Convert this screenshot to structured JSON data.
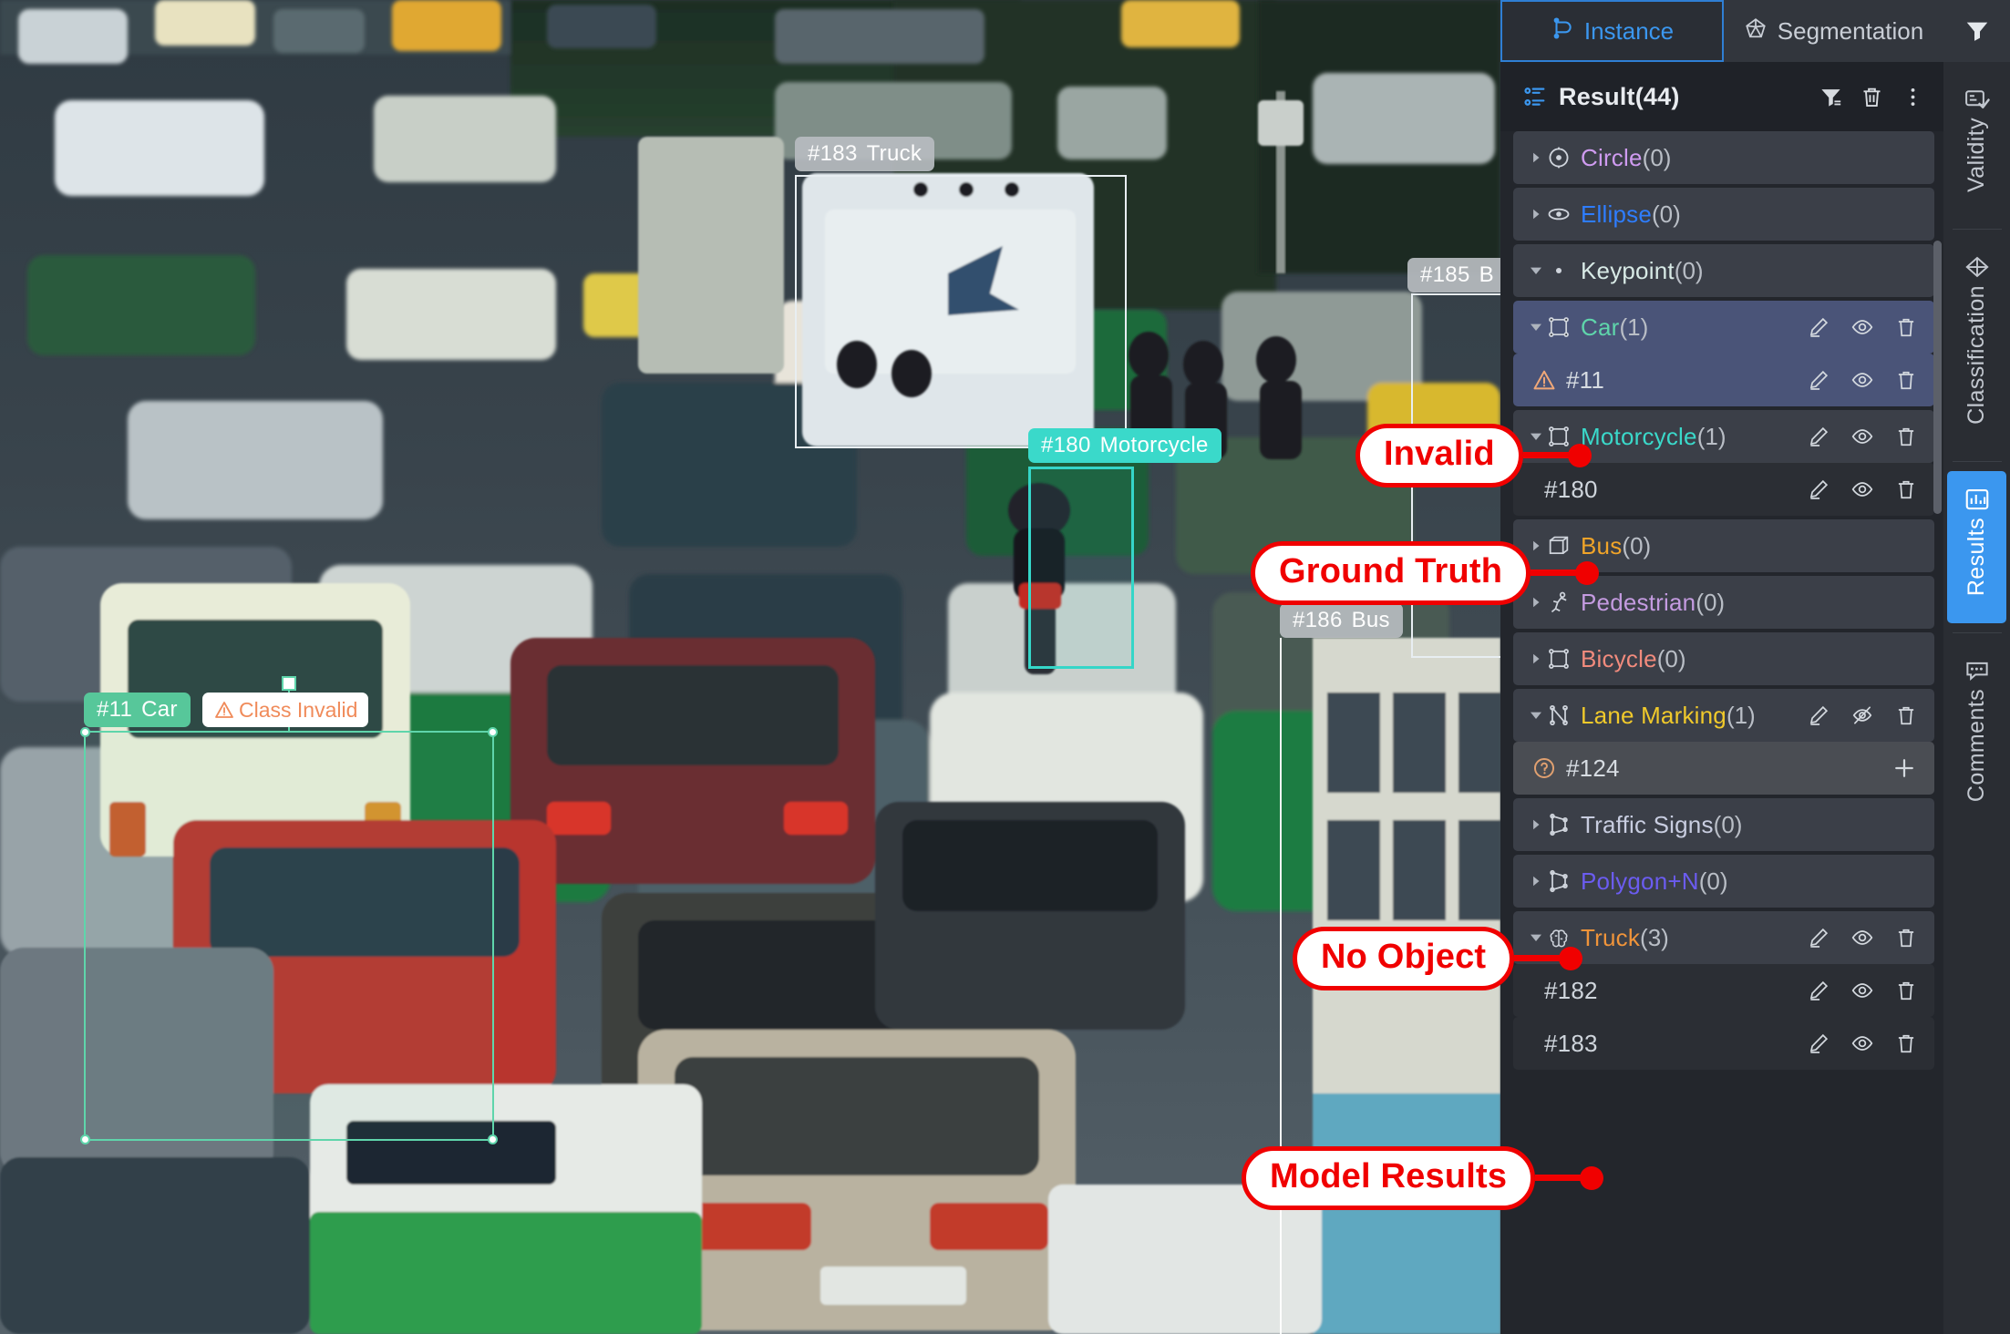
{
  "tabs": {
    "items": [
      {
        "label": "Instance",
        "icon": "polyline-icon",
        "active": true
      },
      {
        "label": "Segmentation",
        "icon": "segmentation-icon",
        "active": false
      }
    ],
    "filter_icon": "filter-icon"
  },
  "result_header": {
    "title": "Result(44)",
    "list_icon": "result-list-icon",
    "filter_label": "filter-icon",
    "delete_label": "trash-icon",
    "more_label": "more-vertical-icon"
  },
  "groups": [
    {
      "name": "Circle",
      "count": "(0)",
      "color": "#cf9bf0",
      "icon": "circle-shape-icon",
      "caret": "right",
      "expanded": false,
      "actions": []
    },
    {
      "name": "Ellipse",
      "count": "(0)",
      "color": "#2e7dff",
      "icon": "ellipse-shape-icon",
      "caret": "right",
      "expanded": false,
      "actions": []
    },
    {
      "name": "Keypoint",
      "count": "(0)",
      "color": "#d8eae6",
      "icon": "keypoint-icon",
      "caret": "down",
      "expanded": true,
      "actions": []
    },
    {
      "name": "Car",
      "count": "(1)",
      "color": "#5fd5ab",
      "icon": "bbox-icon",
      "caret": "down",
      "expanded": true,
      "selected": true,
      "actions": [
        "edit-icon",
        "eye-icon",
        "trash-icon"
      ]
    },
    {
      "name": "Motorcycle",
      "count": "(1)",
      "color": "#3ad9ca",
      "icon": "bbox-icon",
      "caret": "down",
      "expanded": true,
      "actions": [
        "edit-icon",
        "eye-icon",
        "trash-icon"
      ]
    },
    {
      "name": "Bus",
      "count": "(0)",
      "color": "#f0a429",
      "icon": "cuboid-icon",
      "caret": "right",
      "expanded": false,
      "actions": []
    },
    {
      "name": "Pedestrian",
      "count": "(0)",
      "color": "#c49be0",
      "icon": "skeleton-icon",
      "caret": "right",
      "expanded": false,
      "actions": []
    },
    {
      "name": "Bicycle",
      "count": "(0)",
      "color": "#f28b7d",
      "icon": "bbox-icon",
      "caret": "right",
      "expanded": false,
      "actions": []
    },
    {
      "name": "Lane Marking",
      "count": "(1)",
      "color": "#f0c92b",
      "icon": "polyline-shape-icon",
      "caret": "down",
      "expanded": true,
      "actions": [
        "edit-icon",
        "eye-off-icon",
        "trash-icon"
      ]
    },
    {
      "name": "Traffic Signs",
      "count": "(0)",
      "color": "#c8cde0",
      "icon": "polygon-icon",
      "caret": "right",
      "expanded": false,
      "actions": []
    },
    {
      "name": "Polygon+N",
      "count": "(0)",
      "color": "#6b5cf0",
      "icon": "polygon-icon",
      "caret": "right",
      "expanded": false,
      "actions": []
    },
    {
      "name": "Truck",
      "count": "(3)",
      "color": "#f0943a",
      "icon": "brain-icon",
      "caret": "down",
      "expanded": true,
      "actions": [
        "edit-icon",
        "eye-icon",
        "trash-icon"
      ]
    }
  ],
  "children": {
    "Car": [
      {
        "id": "#11",
        "status_icon": "warning-triangle-icon",
        "selected": true,
        "actions": [
          "edit-icon",
          "eye-icon",
          "trash-icon"
        ]
      }
    ],
    "Motorcycle": [
      {
        "id": "#180",
        "status_icon": null,
        "actions": [
          "edit-icon",
          "eye-icon",
          "trash-icon"
        ]
      }
    ],
    "Lane Marking": [
      {
        "id": "#124",
        "status_icon": "question-circle-icon",
        "highlighted": true,
        "actions": [
          "plus-icon"
        ]
      }
    ],
    "Truck": [
      {
        "id": "#182",
        "status_icon": null,
        "actions": [
          "edit-icon",
          "eye-icon",
          "trash-icon"
        ]
      },
      {
        "id": "#183",
        "status_icon": null,
        "actions": [
          "edit-icon",
          "eye-icon",
          "trash-icon"
        ]
      }
    ]
  },
  "side_rail": {
    "items": [
      {
        "label": "Validity",
        "icon": "validity-icon",
        "active": false
      },
      {
        "label": "Classification",
        "icon": "classification-icon",
        "active": false
      },
      {
        "label": "Results",
        "icon": "results-icon",
        "active": true
      },
      {
        "label": "Comments",
        "icon": "comments-icon",
        "active": false
      }
    ]
  },
  "image_tags": [
    {
      "id": "#183",
      "cls": "Truck",
      "style": "gray"
    },
    {
      "id": "#180",
      "cls": "Motorcycle",
      "style": "cyan"
    },
    {
      "id": "#185",
      "cls": "B",
      "style": "gray"
    },
    {
      "id": "#186",
      "cls": "Bus",
      "style": "gray"
    },
    {
      "id": "#11",
      "cls": "Car",
      "style": "green"
    }
  ],
  "warning_tag": {
    "text": "Class Invalid",
    "icon": "warning-triangle-icon",
    "color": "#f08b5a"
  },
  "callouts": [
    {
      "label": "Invalid",
      "target": "car-child-row-11"
    },
    {
      "label": "Ground Truth",
      "target": "motorcycle-child-row-180"
    },
    {
      "label": "No Object",
      "target": "lane-marking-child-row-124"
    },
    {
      "label": "Model Results",
      "target": "truck-group-row"
    }
  ],
  "colors": {
    "callout_red": "#f00000",
    "accent_blue": "#3b97ef",
    "panel_bg": "#23262c",
    "row_bg": "#3b3f48",
    "row_selected": "#4a5478"
  }
}
